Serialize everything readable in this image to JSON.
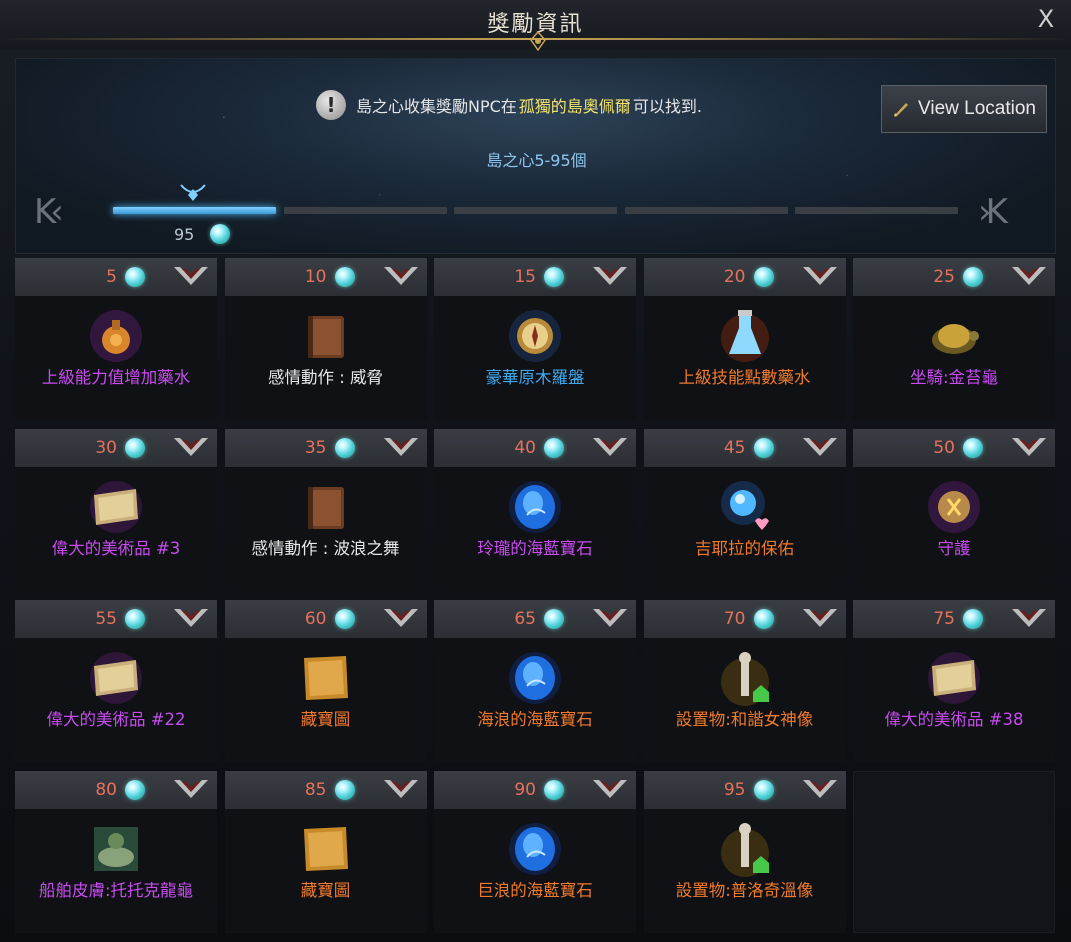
{
  "window": {
    "title": "獎勵資訊",
    "close_label": "X"
  },
  "header": {
    "notice_prefix": "島之心收集獎勵NPC在",
    "notice_place": "孤獨的島奧佩爾",
    "notice_suffix": "可以找到.",
    "view_location_label": "View Location",
    "range_label": "島之心5-95個",
    "prev_label": "K‹",
    "next_label": "›K",
    "progress_count": "95",
    "progress_segments": 5,
    "progress_active": 1
  },
  "colors": {
    "purple": "#c84cf0",
    "white": "#e8e8e8",
    "blue": "#3ea8f0",
    "orange": "#f07a2e",
    "number_red": "#e6715a",
    "accent_gold": "#c9a557"
  },
  "rewards": [
    {
      "num": "5",
      "label": "上級能力值增加藥水",
      "color": "#c84cf0",
      "icon": "potion-icon"
    },
    {
      "num": "10",
      "label": "感情動作 : 威脅",
      "color": "#e8e8e8",
      "icon": "book-icon"
    },
    {
      "num": "15",
      "label": "豪華原木羅盤",
      "color": "#3ea8f0",
      "icon": "compass-icon"
    },
    {
      "num": "20",
      "label": "上級技能點數藥水",
      "color": "#f07a2e",
      "icon": "flask-icon"
    },
    {
      "num": "25",
      "label": "坐騎:金苔龜",
      "color": "#c84cf0",
      "icon": "turtle-icon"
    },
    {
      "num": "30",
      "label": "偉大的美術品 #3",
      "color": "#c84cf0",
      "icon": "painting-icon"
    },
    {
      "num": "35",
      "label": "感情動作 : 波浪之舞",
      "color": "#e8e8e8",
      "icon": "book-icon"
    },
    {
      "num": "40",
      "label": "玲瓏的海藍寶石",
      "color": "#c84cf0",
      "icon": "sapphire-icon"
    },
    {
      "num": "45",
      "label": "吉耶拉的保佑",
      "color": "#f07a2e",
      "icon": "blessing-gem-icon"
    },
    {
      "num": "50",
      "label": "守護",
      "color": "#c84cf0",
      "icon": "rune-icon"
    },
    {
      "num": "55",
      "label": "偉大的美術品 #22",
      "color": "#c84cf0",
      "icon": "painting-icon"
    },
    {
      "num": "60",
      "label": "藏寶圖",
      "color": "#f07a2e",
      "icon": "treasure-map-icon"
    },
    {
      "num": "65",
      "label": "海浪的海藍寶石",
      "color": "#f07a2e",
      "icon": "sapphire-icon"
    },
    {
      "num": "70",
      "label": "設置物:和諧女神像",
      "color": "#f07a2e",
      "icon": "statue-icon"
    },
    {
      "num": "75",
      "label": "偉大的美術品 #38",
      "color": "#c84cf0",
      "icon": "painting-icon"
    },
    {
      "num": "80",
      "label": "船舶皮膚:托托克龍龜",
      "color": "#c84cf0",
      "icon": "ship-skin-icon"
    },
    {
      "num": "85",
      "label": "藏寶圖",
      "color": "#f07a2e",
      "icon": "treasure-map-icon"
    },
    {
      "num": "90",
      "label": "巨浪的海藍寶石",
      "color": "#f07a2e",
      "icon": "sapphire-icon"
    },
    {
      "num": "95",
      "label": "設置物:普洛奇溫像",
      "color": "#f07a2e",
      "icon": "statue-icon"
    }
  ]
}
